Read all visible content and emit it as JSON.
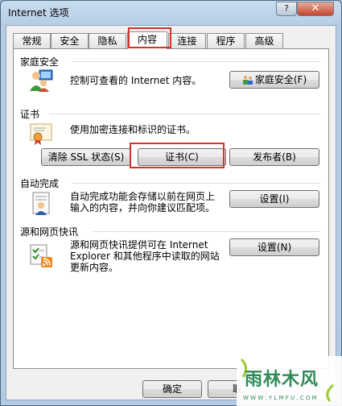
{
  "window": {
    "title": "Internet 选项",
    "help_label": "?",
    "close_label": "✕"
  },
  "tabs": [
    {
      "label": "常规",
      "active": false
    },
    {
      "label": "安全",
      "active": false
    },
    {
      "label": "隐私",
      "active": false
    },
    {
      "label": "内容",
      "active": true
    },
    {
      "label": "连接",
      "active": false
    },
    {
      "label": "程序",
      "active": false
    },
    {
      "label": "高级",
      "active": false
    }
  ],
  "sections": {
    "family": {
      "title": "家庭安全",
      "description": "控制可查看的 Internet 内容。",
      "button_label": "家庭安全(F)"
    },
    "certificates": {
      "title": "证书",
      "description": "使用加密连接和标识的证书。",
      "clear_ssl_label": "清除 SSL 状态(S)",
      "certificates_label": "证书(C)",
      "publishers_label": "发布者(B)"
    },
    "autocomplete": {
      "title": "自动完成",
      "description_line1": "自动完成功能会存储以前在网页上",
      "description_line2": "输入的内容，并向你建议匹配项。",
      "settings_label": "设置(I)"
    },
    "feeds": {
      "title": "源和网页快讯",
      "description_line1": "源和网页快讯提供可在 Internet",
      "description_line2": "Explorer 和其他程序中读取的网站",
      "description_line3": "更新内容。",
      "settings_label": "设置(N)"
    }
  },
  "footer": {
    "ok_label": "确定",
    "cancel_label": "取"
  },
  "watermark": {
    "brand": "雨林木风",
    "url": "W W W . Y L M F U . C O M"
  },
  "colors": {
    "highlight": "#d9322b",
    "titlebar": "#b9cfe6",
    "watermark_green": "#2e8b57"
  }
}
